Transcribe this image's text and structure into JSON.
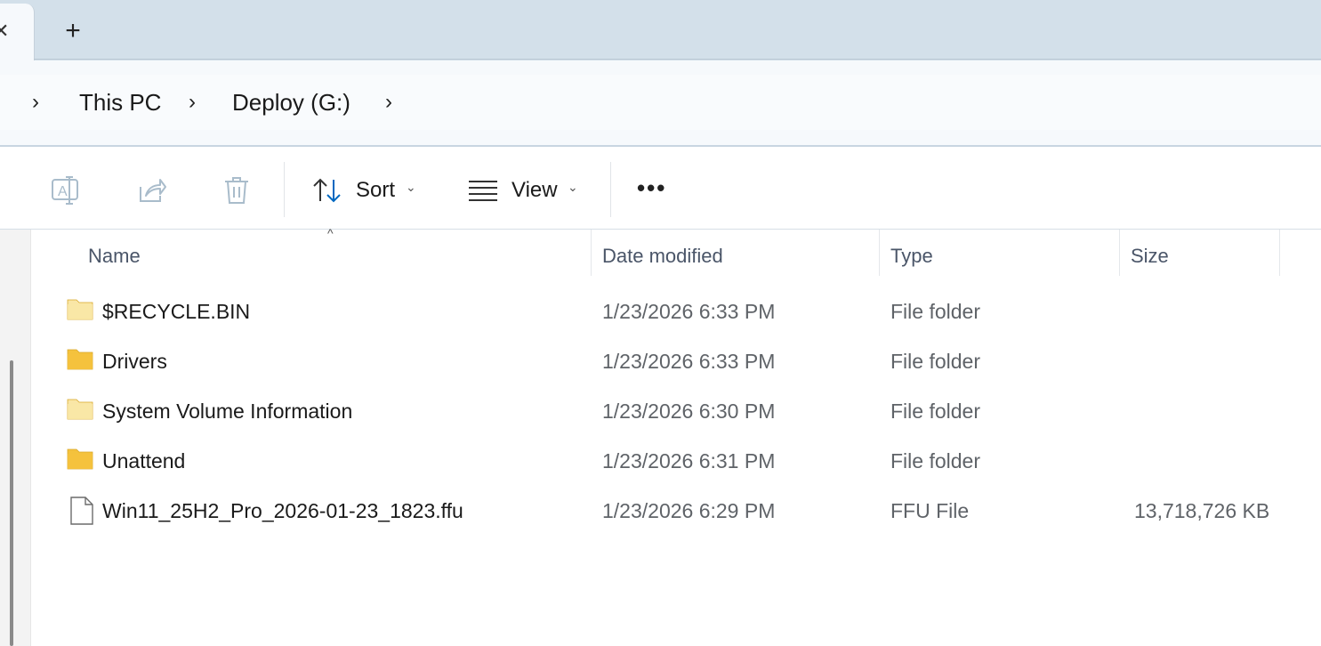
{
  "tabs": {
    "close_glyph": "✕",
    "new_tab_glyph": "+"
  },
  "breadcrumb": {
    "items": [
      "This PC",
      "Deploy (G:)"
    ]
  },
  "toolbar": {
    "sort_label": "Sort",
    "view_label": "View",
    "more_label": "•••",
    "icons": [
      "rename-icon",
      "share-icon",
      "delete-icon",
      "sort-icon",
      "view-icon"
    ]
  },
  "columns": {
    "name": "Name",
    "date": "Date modified",
    "type": "Type",
    "size": "Size"
  },
  "files": [
    {
      "name": "$RECYCLE.BIN",
      "date": "1/23/2026 6:33 PM",
      "type": "File folder",
      "size": "",
      "icon": "folder-hidden"
    },
    {
      "name": "Drivers",
      "date": "1/23/2026 6:33 PM",
      "type": "File folder",
      "size": "",
      "icon": "folder"
    },
    {
      "name": "System Volume Information",
      "date": "1/23/2026 6:30 PM",
      "type": "File folder",
      "size": "",
      "icon": "folder-hidden"
    },
    {
      "name": "Unattend",
      "date": "1/23/2026 6:31 PM",
      "type": "File folder",
      "size": "",
      "icon": "folder"
    },
    {
      "name": "Win11_25H2_Pro_2026-01-23_1823.ffu",
      "date": "1/23/2026 6:29 PM",
      "type": "FFU File",
      "size": "13,718,726 KB",
      "icon": "file"
    }
  ],
  "colors": {
    "folder": "#f4c23d",
    "folder_hidden": "#f9e6a6",
    "accent": "#0067c0"
  }
}
